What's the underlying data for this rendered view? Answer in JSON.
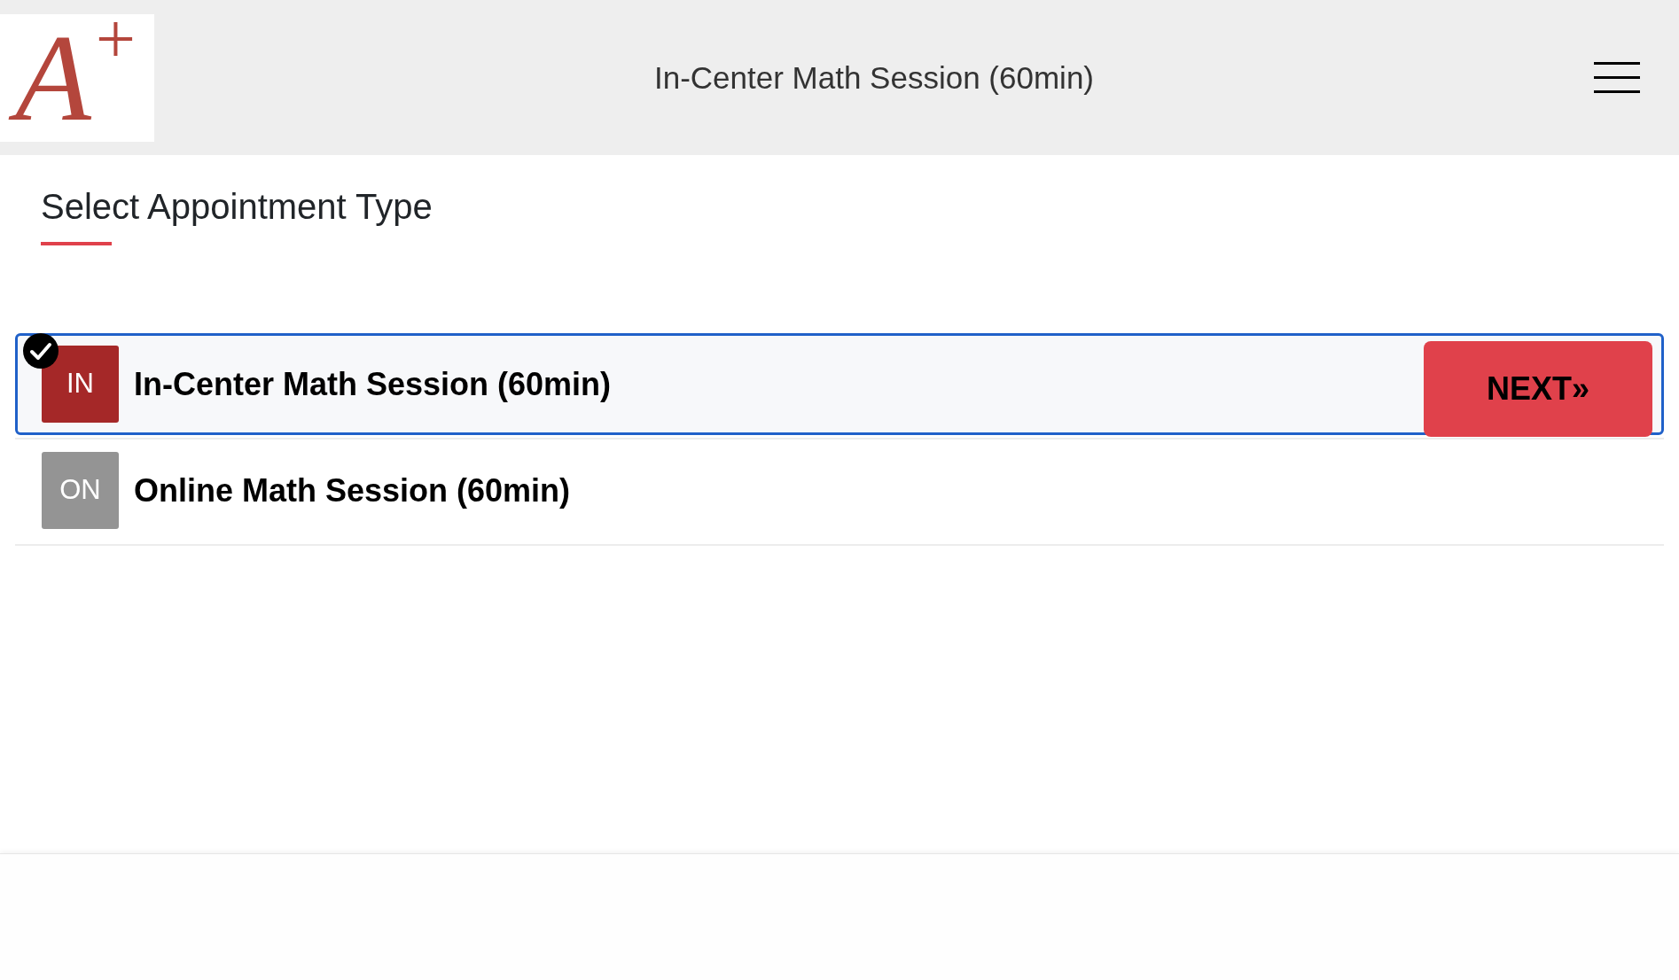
{
  "header": {
    "logo": "A$^{+}$",
    "title": "In-Center Math Session (60min)"
  },
  "heading": "Select Appointment Type",
  "appointment_types": [
    {
      "badge": "IN",
      "name": "In-Center Math Session (60min)",
      "color": "#a52828",
      "selected": true
    },
    {
      "badge": "ON",
      "name": "Online Math Session (60min)",
      "color": "#949494",
      "selected": false
    }
  ],
  "next_button": {
    "label": "NEXT»"
  }
}
